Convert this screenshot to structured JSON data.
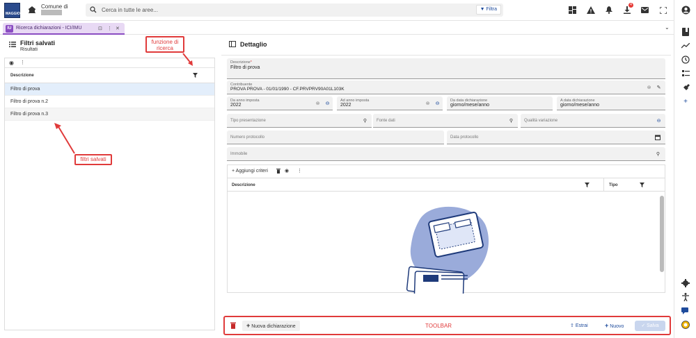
{
  "app": {
    "logo_text": "MAGGIOLI",
    "comune_label": "Comune di"
  },
  "search": {
    "placeholder": "Cerca in tutte le aree...",
    "filter_label": "Filtra"
  },
  "notifications": {
    "downloads_badge": "4"
  },
  "tab": {
    "label": "Ricerca dichiarazioni - ICI/IMU",
    "icon_text": "IU"
  },
  "left_panel": {
    "title": "Filtri salvati",
    "subtitle": "Risultati",
    "column_header": "Descrizione",
    "rows": [
      "Filtro di prova",
      "Filtro di prova n.2",
      "Filtro di prova n.3"
    ]
  },
  "right_panel": {
    "title": "Dettaglio",
    "fields": {
      "descrizione": {
        "label": "Descrizione",
        "value": "Filtro di prova"
      },
      "contribuente": {
        "label": "Contribuente",
        "value": "PROVA PROVA - 01/01/1990 - CF.PRVPRV90A01L103K"
      },
      "da_anno": {
        "label": "Da anno imposta",
        "value": "2022"
      },
      "ad_anno": {
        "label": "Ad anno imposta",
        "value": "2022"
      },
      "da_data": {
        "label": "Da data dichiarazione",
        "value": "giorno/mese/anno"
      },
      "a_data": {
        "label": "A data dichiarazione",
        "value": "giorno/mese/anno"
      },
      "tipo_presentazione": {
        "placeholder": "Tipo presentazione"
      },
      "fonte_dati": {
        "placeholder": "Fonte dati"
      },
      "qualita_variazione": {
        "placeholder": "Qualità variazione"
      },
      "numero_protocollo": {
        "placeholder": "Numero protocollo"
      },
      "data_protocollo": {
        "placeholder": "Data protocollo"
      },
      "immobile": {
        "placeholder": "Immobile"
      }
    },
    "criteria": {
      "add_label": "Aggiungi criteri",
      "col_descrizione": "Descrizione",
      "col_tipo": "Tipo"
    }
  },
  "toolbar": {
    "new_decl_label": "Nuova dichiarazione",
    "estrai_label": "Estrai",
    "nuovo_label": "Nuovo",
    "salva_label": "Salva"
  },
  "annotations": {
    "search_func": "funzione di ricerca",
    "saved_filters": "filtri salvati",
    "toolbar": "TOOLBAR"
  },
  "colors": {
    "accent": "#1e4b9c",
    "annotation": "#e03a3a",
    "tab": "#8a4cc2"
  }
}
